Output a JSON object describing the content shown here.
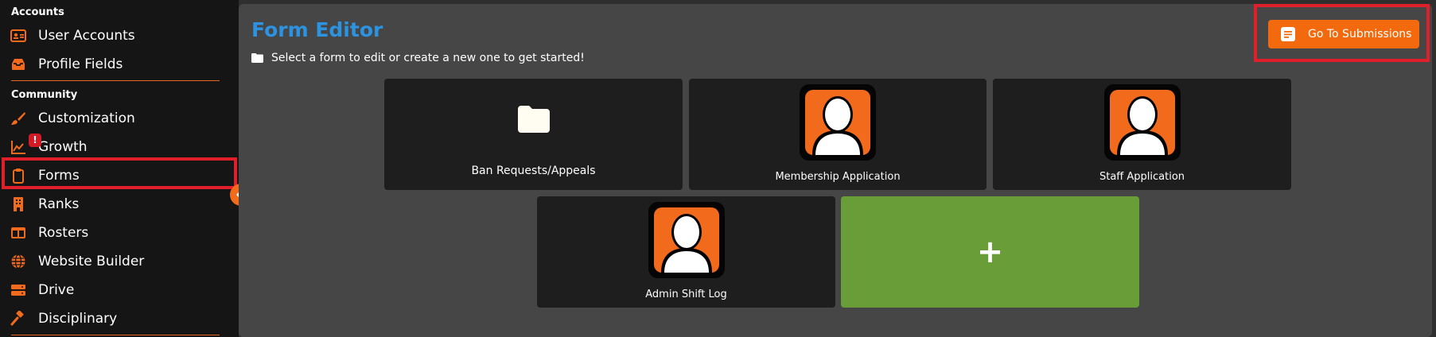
{
  "sidebar": {
    "sections": [
      {
        "title": "Accounts"
      },
      {
        "title": "Community"
      }
    ],
    "items": [
      {
        "label": "User Accounts",
        "icon": "id-card-icon"
      },
      {
        "label": "Profile Fields",
        "icon": "inbox-tray-icon"
      },
      {
        "label": "Customization",
        "icon": "paintbrush-icon"
      },
      {
        "label": "Growth",
        "icon": "chart-line-icon",
        "badge": "!"
      },
      {
        "label": "Forms",
        "icon": "clipboard-icon",
        "selected": true
      },
      {
        "label": "Ranks",
        "icon": "building-icon"
      },
      {
        "label": "Rosters",
        "icon": "columns-icon"
      },
      {
        "label": "Website Builder",
        "icon": "globe-icon"
      },
      {
        "label": "Drive",
        "icon": "hard-drive-icon"
      },
      {
        "label": "Disciplinary",
        "icon": "gavel-icon"
      }
    ],
    "collapse_icon": "chevron-left-icon"
  },
  "main": {
    "title": "Form Editor",
    "subtitle": "Select a form to edit or create a new one to get started!",
    "submissions_button": "Go To Submissions",
    "forms": [
      {
        "label": "Ban Requests/Appeals",
        "icon": "folder-icon"
      },
      {
        "label": "Membership Application",
        "icon": "avatar-icon"
      },
      {
        "label": "Staff Application",
        "icon": "avatar-icon"
      },
      {
        "label": "Admin Shift Log",
        "icon": "avatar-icon"
      }
    ],
    "add_label": "+"
  },
  "colors": {
    "accent": "#f26a0d",
    "title_blue": "#2c93e0",
    "highlight_red": "#e01f2a",
    "add_green": "#689d38"
  }
}
